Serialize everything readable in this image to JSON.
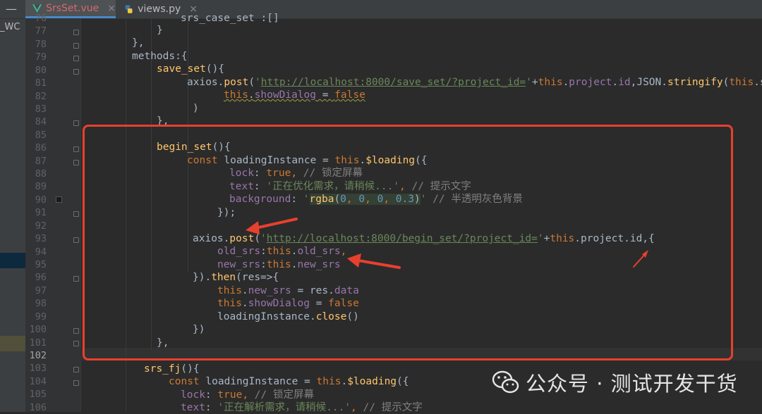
{
  "window": {
    "minimize_glyph": "—",
    "project_label": "_WC"
  },
  "tabs": [
    {
      "name": "SrsSet.vue",
      "close": "×",
      "icon": "vue-icon",
      "active": true
    },
    {
      "name": "views.py",
      "close": "×",
      "icon": "python-icon",
      "active": false
    }
  ],
  "gutter": {
    "lines": [
      "76",
      "77",
      "78",
      "79",
      "80",
      "81",
      "82",
      "83",
      "84",
      "85",
      "86",
      "87",
      "88",
      "89",
      "90",
      "91",
      "92",
      "93",
      "94",
      "95",
      "96",
      "97",
      "98",
      "99",
      "100",
      "101",
      "102",
      "103",
      "104",
      "105",
      "106"
    ],
    "current_line": "102"
  },
  "code": {
    "l76": "srs_case_set :[]",
    "l77": "}",
    "l78": "},",
    "l79": {
      "a": "methods",
      "b": ":{"
    },
    "l80": {
      "a": "save_set",
      "b": "(){"
    },
    "l81": {
      "a": "axios.",
      "b": "post",
      "c": "(",
      "d": "'",
      "e": "http://localhost:8000/save_set/?project_id=",
      "f": "'",
      "g": "+",
      "h": "this",
      "i": ".",
      "j": "project",
      "k": ".",
      "l": "id",
      "m": ",JSON.",
      "n": "stringify",
      "o": "(",
      "p": "this",
      "q": ".sr"
    },
    "l82": {
      "a": "this",
      "b": ".",
      "c": "showDialog",
      "d": " = ",
      "e": "false"
    },
    "l83": ")",
    "l84": "},",
    "l86": {
      "a": "begin_set",
      "b": "(){"
    },
    "l87": {
      "a": "const",
      "b": " loadingInstance = ",
      "c": "this",
      "d": ".",
      "e": "$loading",
      "f": "({"
    },
    "l88": {
      "a": "lock",
      "b": ": ",
      "c": "true",
      "d": ", ",
      "e": "// 锁定屏幕"
    },
    "l89": {
      "a": "text",
      "b": ": ",
      "c": "'正在优化需求，请稍候...'",
      "d": ", ",
      "e": "// 提示文字"
    },
    "l90": {
      "a": "background",
      "b": ": ",
      "c": "'",
      "d": "rgba",
      "e": "(",
      "f": "0",
      "g": ", ",
      "h": "0",
      "i": ", ",
      "j": "0",
      "k": ", ",
      "l": "0.3",
      "m": ")",
      "n": "'",
      "o": " // 半透明灰色背景"
    },
    "l91": "});",
    "l93": {
      "a": "axios.",
      "b": "post",
      "c": "(",
      "d": "'",
      "e": "http://localhost:8000/begin_set/?project_id=",
      "f": "'",
      "g": "+",
      "h": "this",
      "i": ".project.id,{"
    },
    "l94": {
      "a": "old_srs",
      "b": ":",
      "c": "this",
      "d": ".",
      "e": "old_srs",
      "f": ","
    },
    "l95": {
      "a": "new_srs",
      "b": ":",
      "c": "this",
      "d": ".",
      "e": "new_srs"
    },
    "l96": {
      "a": "}).",
      "b": "then",
      "c": "(res=>{"
    },
    "l97": {
      "a": "this",
      "b": ".",
      "c": "new_srs",
      "d": " = res.",
      "e": "data"
    },
    "l98": {
      "a": "this",
      "b": ".",
      "c": "showDialog",
      "d": " = ",
      "e": "false"
    },
    "l99": {
      "a": "loadingInstance.",
      "b": "close",
      "c": "()"
    },
    "l100": "})",
    "l101": "},",
    "l103": {
      "a": "srs_fj",
      "b": "(){"
    },
    "l104": {
      "a": "const",
      "b": " loadingInstance = ",
      "c": "this",
      "d": ".",
      "e": "$loading",
      "f": "({"
    },
    "l105": {
      "a": "lock",
      "b": ": ",
      "c": "true",
      "d": ", ",
      "e": "// 锁定屏幕"
    },
    "l106": {
      "a": "text",
      "b": ": ",
      "c": "'正在解析需求，请稍候...'",
      "d": ", ",
      "e": "// 提示文字"
    }
  },
  "watermark": {
    "icon": "wechat-icon",
    "text": "公众号 · 测试开发干货"
  },
  "colors": {
    "annotation_red": "#e8402e",
    "editor_bg": "#2b2b2b",
    "keyword": "#cc7832",
    "function": "#ffc66d",
    "string": "#6a8759",
    "property": "#9876aa"
  }
}
